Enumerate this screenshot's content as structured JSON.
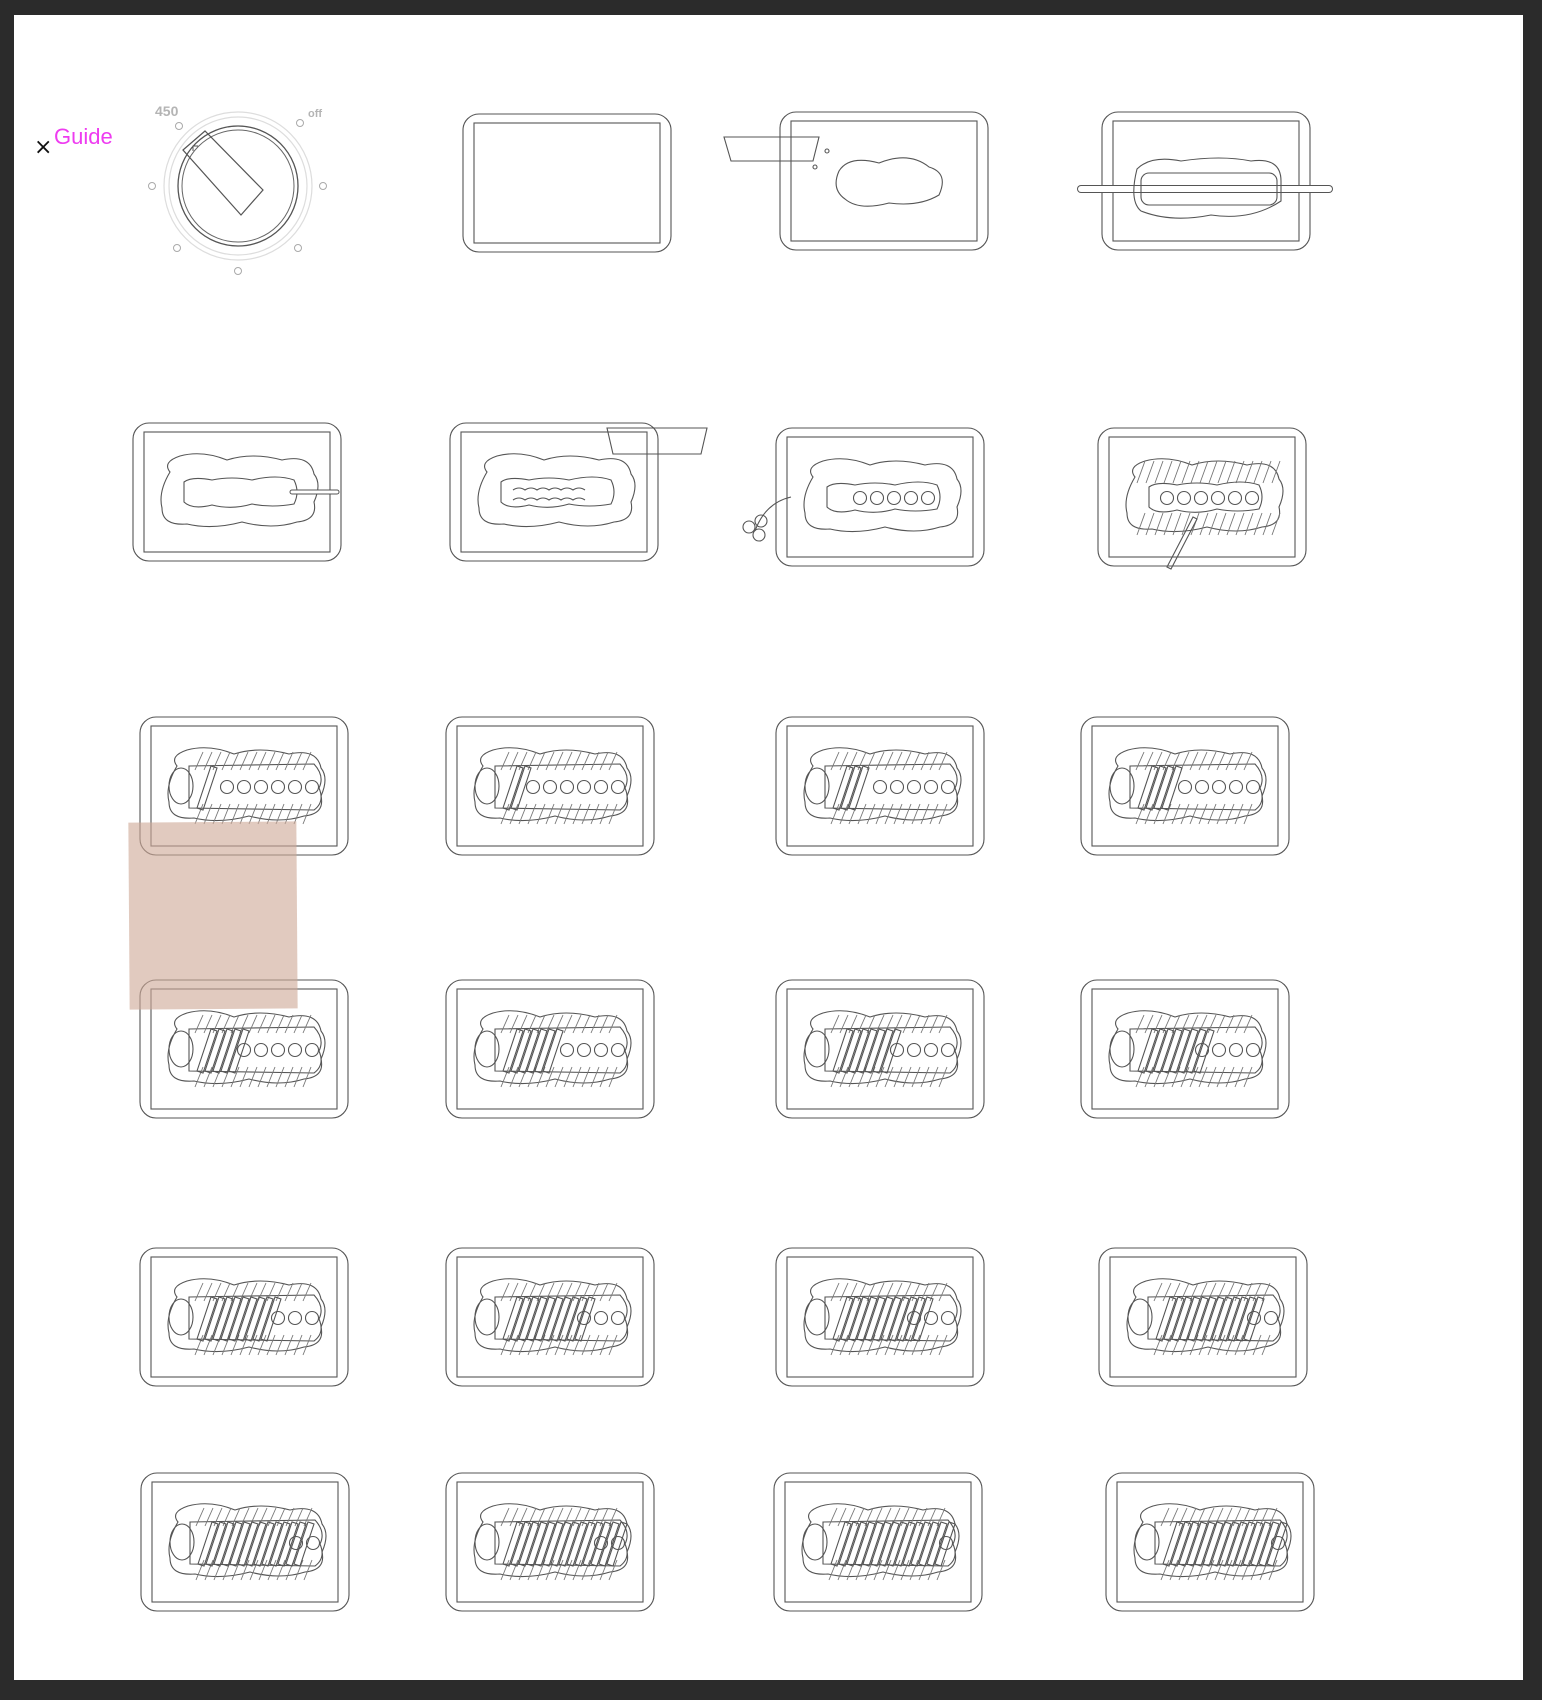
{
  "window": {
    "background": "#2b2b2b",
    "canvas_background": "#ffffff"
  },
  "guide": {
    "close_label": "×",
    "label": "Guide",
    "accent": "#ee3cf0"
  },
  "oven_dial": {
    "max_label": "450",
    "off_label": "off"
  },
  "steps": [
    {
      "stage": "empty-tray"
    },
    {
      "stage": "pour-dough"
    },
    {
      "stage": "roll-dough"
    },
    {
      "stage": "spread-sauce"
    },
    {
      "stage": "sprinkle-cheese"
    },
    {
      "stage": "add-toppings"
    },
    {
      "stage": "cut-strips"
    },
    {
      "stage": "braid-1"
    },
    {
      "stage": "braid-2"
    },
    {
      "stage": "braid-3"
    },
    {
      "stage": "braid-4"
    },
    {
      "stage": "braid-5"
    },
    {
      "stage": "braid-6"
    },
    {
      "stage": "braid-7"
    },
    {
      "stage": "braid-8"
    },
    {
      "stage": "braid-9"
    },
    {
      "stage": "braid-10"
    },
    {
      "stage": "braid-11"
    },
    {
      "stage": "braid-12"
    },
    {
      "stage": "braid-13"
    },
    {
      "stage": "braid-14"
    },
    {
      "stage": "braid-15"
    },
    {
      "stage": "braid-16"
    }
  ],
  "sticky_note": {
    "color": "#ceaa98"
  }
}
